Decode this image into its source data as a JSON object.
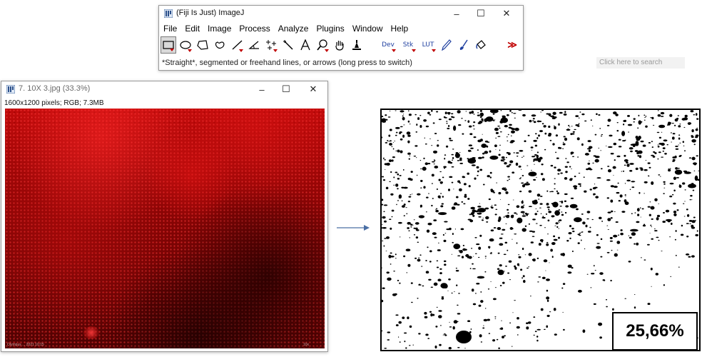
{
  "imagej_window": {
    "title": "(Fiji Is Just) ImageJ",
    "controls": [
      "–",
      "☐",
      "✕"
    ],
    "menu": [
      "File",
      "Edit",
      "Image",
      "Process",
      "Analyze",
      "Plugins",
      "Window",
      "Help"
    ],
    "tools": [
      {
        "name": "rectangle-tool",
        "selected": true,
        "submenu": true
      },
      {
        "name": "oval-tool",
        "submenu": true
      },
      {
        "name": "polygon-tool"
      },
      {
        "name": "freehand-tool"
      },
      {
        "name": "straight-line-tool",
        "submenu": true
      },
      {
        "name": "angle-tool"
      },
      {
        "name": "multipoint-tool",
        "submenu": true
      },
      {
        "name": "wand-tool"
      },
      {
        "name": "text-tool"
      },
      {
        "name": "magnifying-glass-tool",
        "submenu": true
      },
      {
        "name": "hand-tool"
      },
      {
        "name": "color-picker-tool"
      }
    ],
    "text_tools": [
      {
        "label": "Dev",
        "name": "dev-menu-tool"
      },
      {
        "label": "Stk",
        "name": "stack-menu-tool"
      },
      {
        "label": "LUT",
        "name": "lut-menu-tool"
      }
    ],
    "extra_tools": [
      "pencil-tool",
      "brush-tool",
      "flood-fill-tool"
    ],
    "more_label": "≫",
    "status": "*Straight*, segmented or freehand lines, or arrows (long press to switch)",
    "search_placeholder": "Click here to search"
  },
  "image_window": {
    "title": "7. 10X 3.jpg (33.3%)",
    "controls": [
      "–",
      "☐",
      "✕"
    ],
    "info": "1600x1200 pixels; RGB; 7.3MB",
    "footer_left": "Olympus ... 2021 10:15",
    "footer_right": "10x"
  },
  "result": {
    "percentage": "25,66%"
  },
  "colors": {
    "accent_arrow": "#4a6fa5",
    "fluorescence": "#c00a0a",
    "submenu_marker": "#c00000"
  }
}
